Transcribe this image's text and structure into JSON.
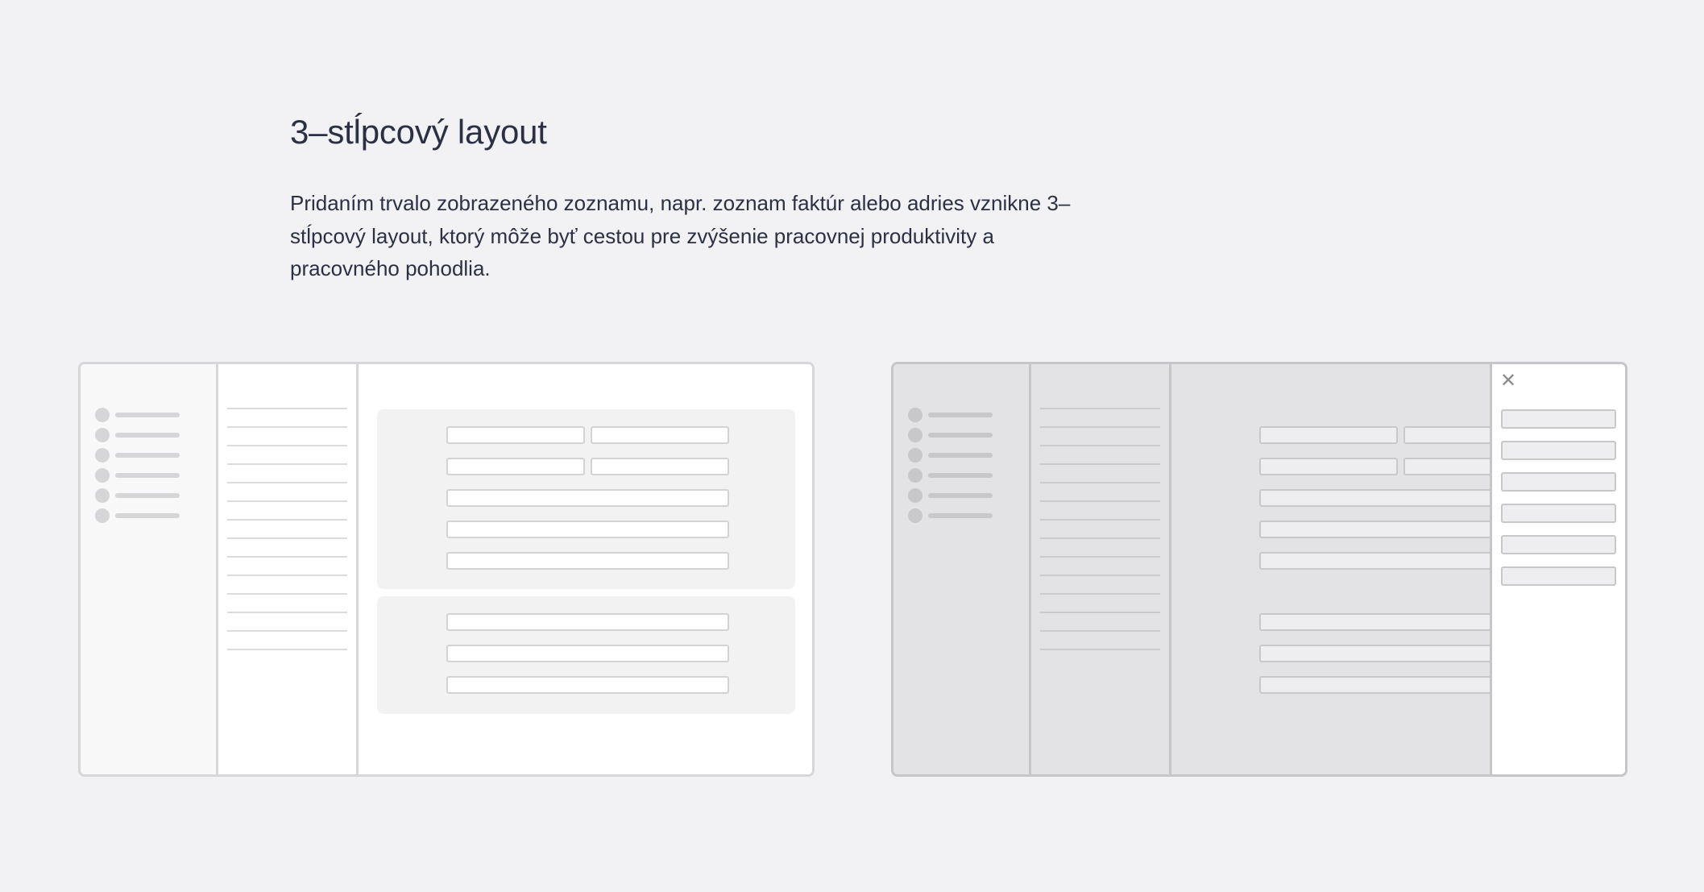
{
  "heading": "3–stĺpcový layout",
  "description": "Pridaním trvalo zobrazeného zoznamu, napr. zoznam faktúr alebo adries vznikne 3–stĺpcový layout, ktorý môže byť cestou pre zvýšenie pracovnej produktivity a pracovného pohodlia.",
  "illustrations": [
    {
      "name": "three-column-layout",
      "nav_items": 6,
      "list_rows": 14,
      "panels": 2
    },
    {
      "name": "three-column-layout-with-drawer",
      "nav_items": 6,
      "list_rows": 14,
      "drawer_fields": 6,
      "drawer_close_icon": "close-icon"
    }
  ],
  "colors": {
    "background": "#f2f2f4",
    "text": "#2b3045",
    "frame_border": "#d7d7da",
    "overlay_dim": "#e3e3e6"
  }
}
